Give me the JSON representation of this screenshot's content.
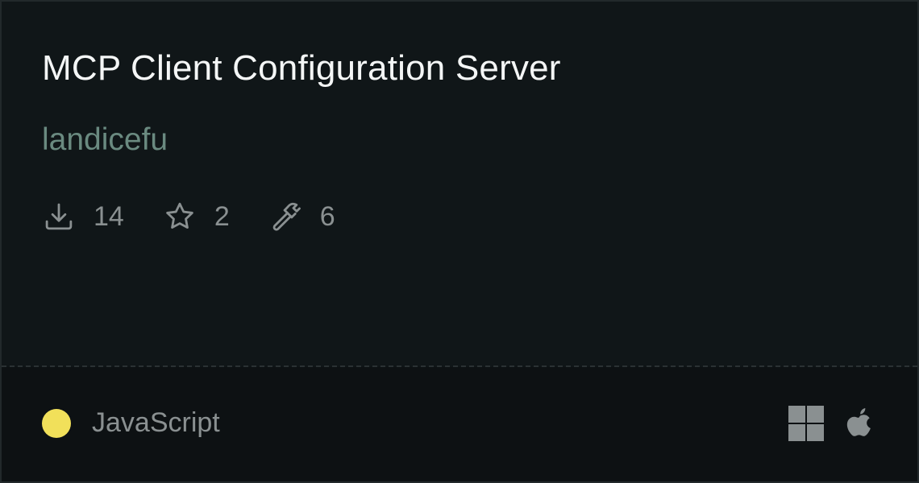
{
  "server": {
    "title": "MCP Client Configuration Server",
    "author": "landicefu"
  },
  "stats": {
    "downloads": "14",
    "stars": "2",
    "tools": "6"
  },
  "icons": {
    "downloads": "download-icon",
    "stars": "star-icon",
    "tools": "hammer-icon",
    "platform_windows": "windows-icon",
    "platform_mac": "apple-icon"
  },
  "language": {
    "name": "JavaScript",
    "color": "#f1e05a"
  },
  "colors": {
    "title": "#f4f6f6",
    "author": "#6a8a80",
    "muted": "#8a9091"
  }
}
